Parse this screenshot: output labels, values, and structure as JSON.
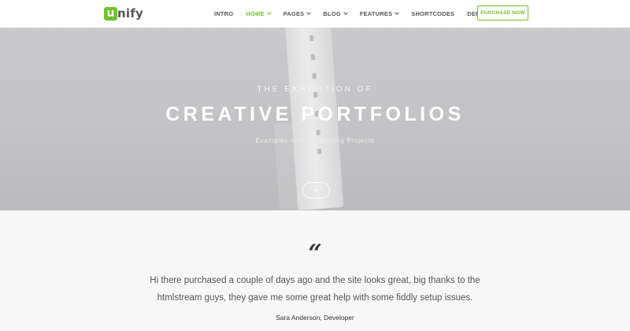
{
  "header": {
    "logo_mark": "u",
    "logo_text": "nify",
    "nav": [
      {
        "label": "INTRO",
        "has_dropdown": false,
        "active": false
      },
      {
        "label": "HOME",
        "has_dropdown": true,
        "active": true
      },
      {
        "label": "PAGES",
        "has_dropdown": true,
        "active": false
      },
      {
        "label": "BLOG",
        "has_dropdown": true,
        "active": false
      },
      {
        "label": "FEATURES",
        "has_dropdown": true,
        "active": false
      },
      {
        "label": "SHORTCODES",
        "has_dropdown": false,
        "active": false
      },
      {
        "label": "DEMOS",
        "has_dropdown": true,
        "active": false
      }
    ],
    "purchase_label": "PURCHASE NOW"
  },
  "hero": {
    "pretitle": "THE EXHIBITION OF",
    "title": "CREATIVE PORTFOLIOS",
    "subtitle": "Examples of Our Branding Projects"
  },
  "testimonial": {
    "quote_mark": "“",
    "text": "Hi there purchased a couple of days ago and the site looks great, big thanks to the htmlstream guys, they gave me some great help with some fiddly setup issues.",
    "author": "Sara Anderson, Developer"
  },
  "colors": {
    "accent": "#72c02c",
    "nav_text": "#555555",
    "hero_bg": "#c4c4c6"
  },
  "icons": {
    "dropdown": "chevron-down-icon",
    "scroll": "scroll-down-icon"
  }
}
